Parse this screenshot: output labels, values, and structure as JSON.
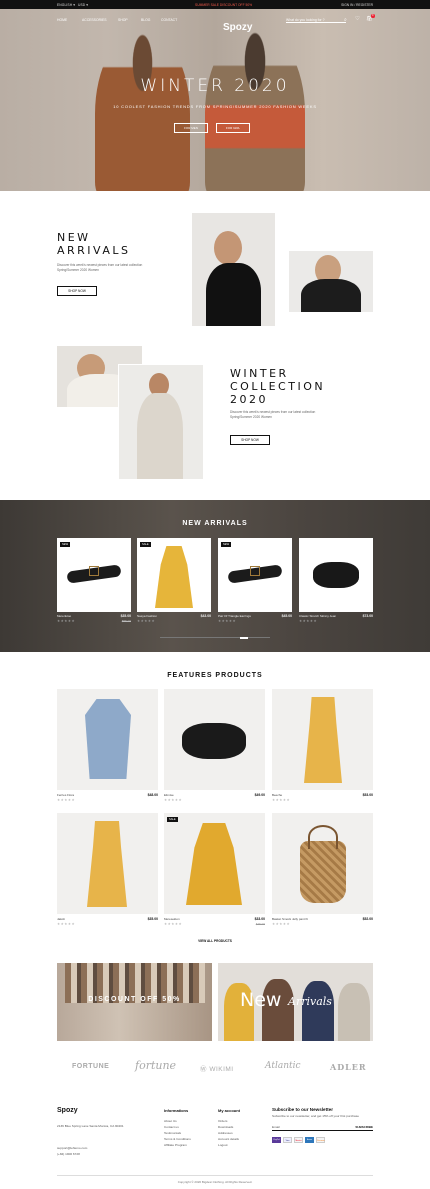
{
  "topbar": {
    "lang": "ENGLISH",
    "currency": "USD",
    "promo": "SUMMER SALE DISCOUNT OFF 50%",
    "account": "SIGN IN / REGISTER"
  },
  "header": {
    "logo": "Spozy",
    "nav": [
      "HOME",
      "ACCESSORIES",
      "SHOP",
      "BLOG",
      "CONTACT"
    ],
    "search_placeholder": "What do you looking for ?",
    "cart_count": "0"
  },
  "hero": {
    "title": "WINTER 2020",
    "subtitle": "10 COOLEST FASHION TRENDS FROM SPRING/SUMMER 2020 FASHION WEEKS",
    "btn_men": "FOR MEN",
    "btn_girl": "FOR GIRL"
  },
  "new_arrivals_block": {
    "title_1": "NEW",
    "title_2": "ARRIVALS",
    "text": "Discover this week's newest pieces from our latest collection Spring/Summer 2020 Women",
    "button": "SHOP NOW"
  },
  "winter_block": {
    "title_1": "WINTER",
    "title_2": "COLLECTION",
    "title_3": "2020",
    "text": "Discover this week's newest pieces from our latest collection Spring/Summer 2020 Women",
    "button": "SHOP NOW"
  },
  "carousel": {
    "title": "NEW ARRIVALS",
    "items": [
      {
        "name": "Merenktoo",
        "price": "$35.00",
        "old_price": "$55.00",
        "badge": "NEW",
        "stars": "★★★★★"
      },
      {
        "name": "Nasya Fashion",
        "price": "$43.00",
        "old_price": "",
        "badge": "SALE",
        "stars": "★★★★★"
      },
      {
        "name": "Pair Of Triangle Earrings",
        "price": "$45.00",
        "old_price": "",
        "badge": "NEW",
        "stars": "★★★★★"
      },
      {
        "name": "Classic Stretch Skinny Jean",
        "price": "$73.00",
        "old_price": "",
        "badge": "",
        "stars": "★★★★★"
      }
    ]
  },
  "features": {
    "title": "FEATURES PRODUCTS",
    "items": [
      {
        "name": "Ferries Flora",
        "price": "$48.00",
        "old_price": "",
        "badge": "",
        "stars": "★★★★★"
      },
      {
        "name": "Elimise",
        "price": "$49.00",
        "old_price": "",
        "badge": "",
        "stars": "★★★★★"
      },
      {
        "name": "Beeche",
        "price": "$53.00",
        "old_price": "",
        "badge": "",
        "stars": "★★★★★"
      },
      {
        "name": "Jakob",
        "price": "$35.00",
        "old_price": "",
        "badge": "",
        "stars": "★★★★★"
      },
      {
        "name": "Meresekton",
        "price": "$33.00",
        "old_price": "$45.00",
        "badge": "SALE",
        "stars": "★★★★★"
      },
      {
        "name": "Basket Smock Jelly pant fit",
        "price": "$52.00",
        "old_price": "",
        "badge": "",
        "stars": "★★★★★"
      }
    ],
    "view_all": "VIEW ALL PRODUCTS"
  },
  "banners": {
    "discount": "DISCOUNT OFF 50%",
    "new_word": "New",
    "arrivals_word": "Arrivals"
  },
  "brands": [
    "FORTUNE",
    "fortune",
    "WIKIMI",
    "Atlantic",
    "ADLER"
  ],
  "footer": {
    "logo": "Spozy",
    "address": "2136 Blue Spring Lane Santa Monica, CA 90401",
    "email": "support@leftemo.com",
    "phone": "(+84) 1900 6728",
    "information_title": "Informations",
    "information": [
      "About Us",
      "Contact us",
      "Testimonials",
      "Terms & Conditions",
      "Affiliate Program"
    ],
    "account_title": "My account",
    "account": [
      "Orders",
      "Downloads",
      "Addresses",
      "Account details",
      "Logout"
    ],
    "newsletter_title": "Subscribe to our Newsletter",
    "newsletter_text": "Subscribe to our newsletter, and get 15% off your first purchase",
    "email_placeholder": "Email",
    "subscribe": "SUBSCRIBE",
    "payments": [
      "PayPal",
      "Visa",
      "Master",
      "Amex",
      "Discover"
    ],
    "copyright": "Copyright © 2020 Bigdesi Clothing. All Rights Reserved."
  }
}
